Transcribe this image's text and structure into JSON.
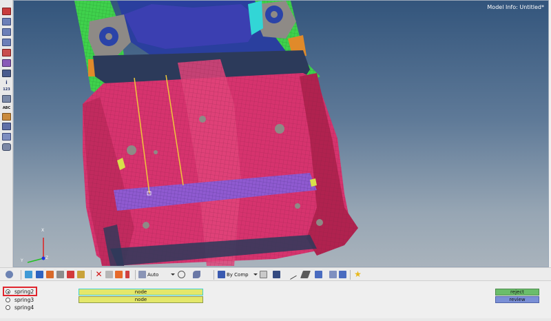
{
  "viewport": {
    "model_info": "Model Info: Untitled*",
    "triad": {
      "x_label": "X",
      "y_label": "Y",
      "z_label": "Z"
    }
  },
  "left_toolbar": {
    "icons": [
      "cube-view-icon",
      "rotate-view-icon",
      "front-view-icon",
      "side-view-icon",
      "top-view-icon",
      "iso-view-icon",
      "shade-icon",
      "wire-icon",
      "info-icon",
      "number-icon",
      "measure-icon",
      "abc-icon",
      "component-icon",
      "mask-icon",
      "cylinder-icon"
    ],
    "labels": {
      "info": "i",
      "number": "123",
      "abc": "ABC"
    }
  },
  "toolbar": {
    "display_mode": "Auto",
    "color_mode": "By Comp"
  },
  "panel": {
    "springs": [
      {
        "label": "spring2",
        "selected": true
      },
      {
        "label": "spring3",
        "selected": false
      },
      {
        "label": "spring4",
        "selected": false
      }
    ],
    "collectors": [
      "node",
      "node"
    ],
    "reject_label": "reject",
    "review_label": "review"
  },
  "colors": {
    "floor": "#d6336e",
    "rail_green": "#3fd14c",
    "crossmember": "#8f5ad0",
    "dark_part": "#2c3a5a",
    "accent_yellow": "#e4e76a"
  }
}
